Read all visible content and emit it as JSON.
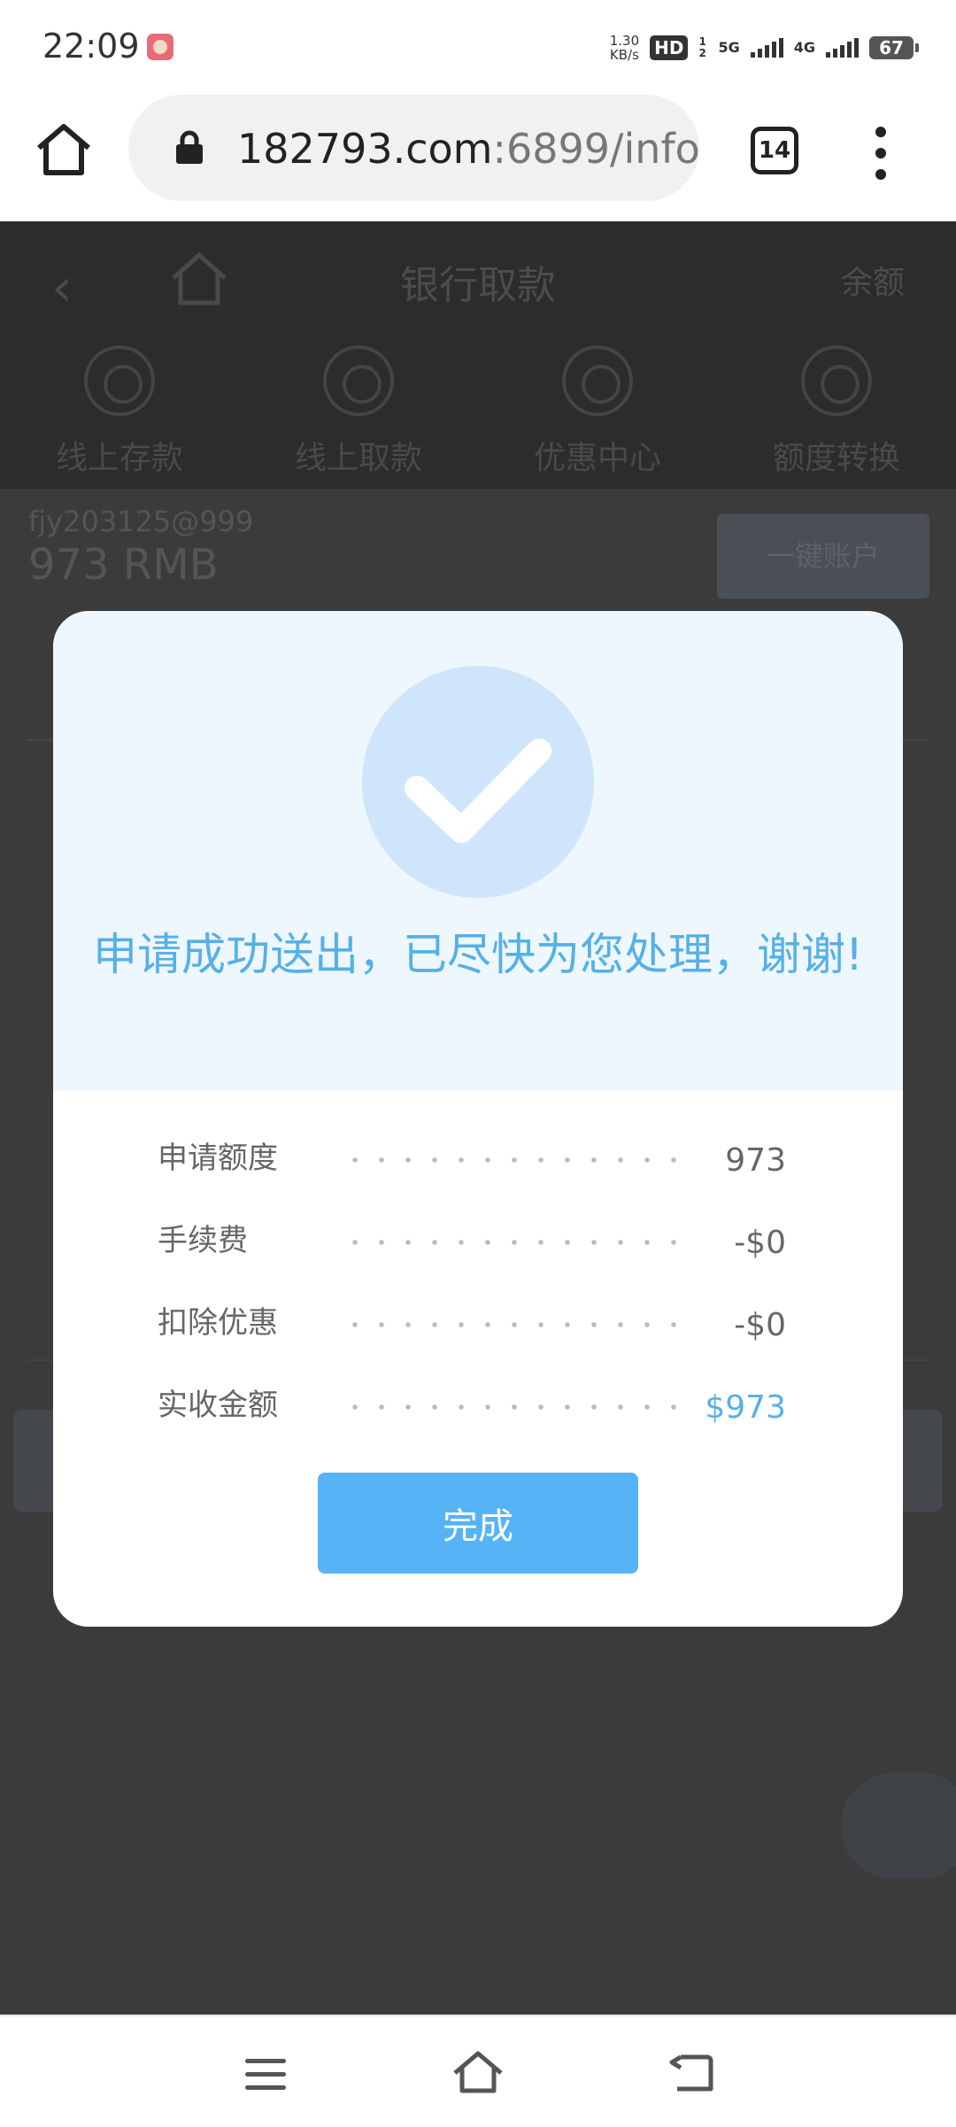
{
  "status_bar": {
    "time": "22:09",
    "speed_value": "1.30",
    "speed_unit": "KB/s",
    "hd_label": "HD",
    "sim_digits": "1 2",
    "net_5g": "5G",
    "net_4g": "4G",
    "battery": "67"
  },
  "browser": {
    "url_main": "182793.com",
    "url_rest": ":6899/info",
    "tab_count": "14"
  },
  "page": {
    "title": "银行取款",
    "balance_link": "余额",
    "nav": [
      {
        "label": "线上存款",
        "icon": "deposit-icon"
      },
      {
        "label": "线上取款",
        "icon": "withdraw-icon"
      },
      {
        "label": "优惠中心",
        "icon": "promo-icon"
      },
      {
        "label": "额度转换",
        "icon": "transfer-icon"
      }
    ],
    "username": "fjy203125@999",
    "amount": "973 RMB",
    "side_button": "一键账户"
  },
  "modal": {
    "message": "申请成功送出，已尽快为您处理，谢谢!",
    "rows": [
      {
        "label": "申请额度",
        "value": "973"
      },
      {
        "label": "手续费",
        "value": "-$0"
      },
      {
        "label": "扣除优惠",
        "value": "-$0"
      },
      {
        "label": "实收金额",
        "value": "$973"
      }
    ],
    "done_label": "完成",
    "accent_color": "#56b4f6"
  }
}
